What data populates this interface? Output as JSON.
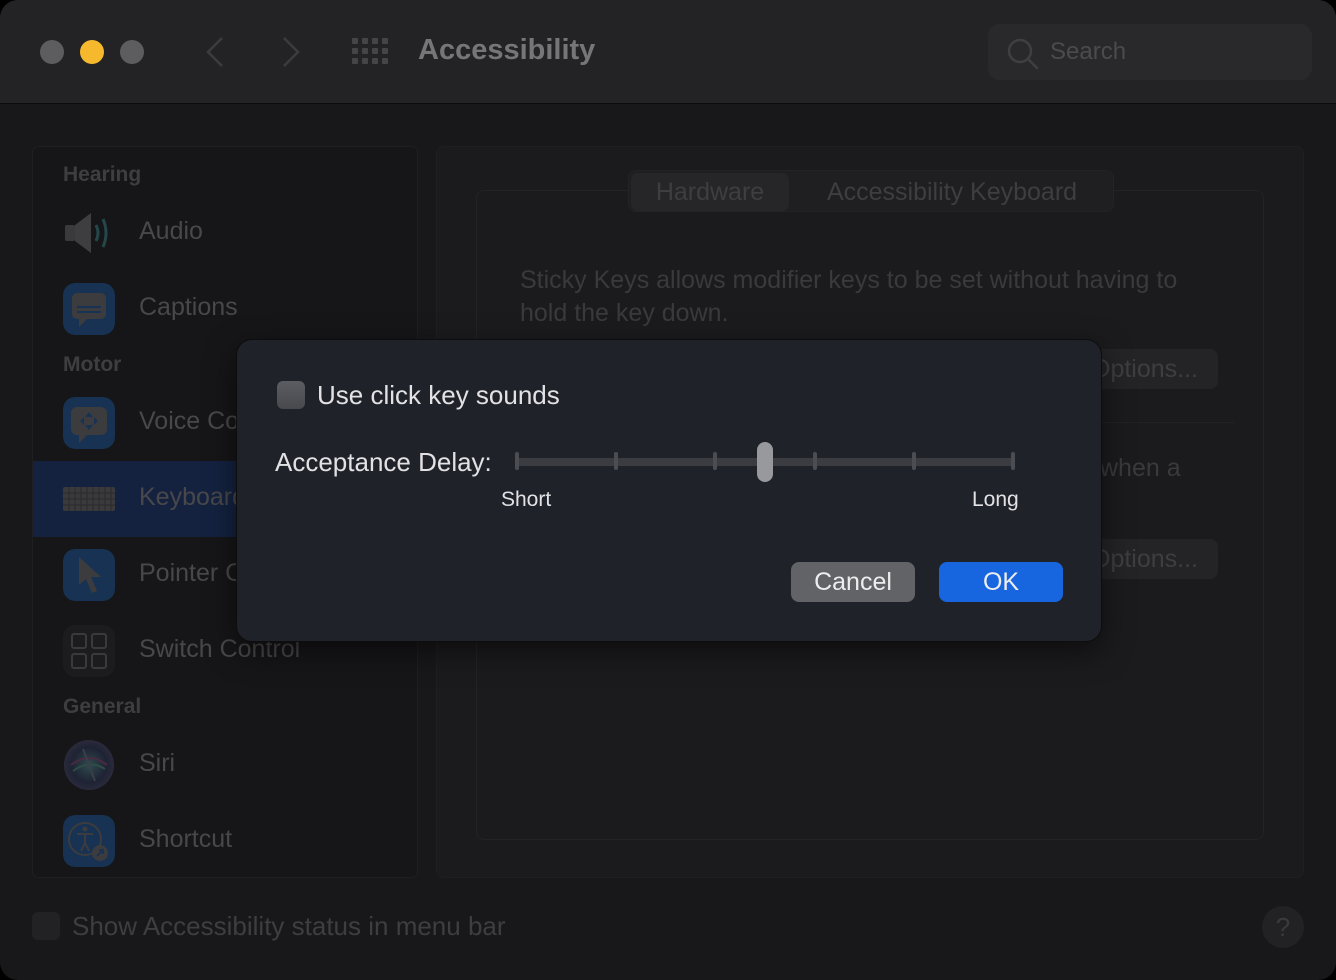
{
  "window": {
    "title": "Accessibility",
    "traffic_lights": [
      "close",
      "minimize",
      "zoom"
    ],
    "search": {
      "placeholder": "Search",
      "value": ""
    }
  },
  "sidebar": {
    "sections": [
      {
        "label": "Hearing"
      },
      {
        "label": "Motor"
      },
      {
        "label": "General"
      }
    ],
    "items": [
      {
        "label": "Audio",
        "icon": "speaker-icon",
        "section": "Hearing"
      },
      {
        "label": "Captions",
        "icon": "captions-icon",
        "section": "Hearing"
      },
      {
        "label": "Voice Control",
        "icon": "voice-control-icon",
        "section": "Motor"
      },
      {
        "label": "Keyboard",
        "icon": "keyboard-icon",
        "section": "Motor",
        "selected": true
      },
      {
        "label": "Pointer Control",
        "icon": "pointer-icon",
        "section": "Motor"
      },
      {
        "label": "Switch Control",
        "icon": "switch-control-icon",
        "section": "Motor"
      },
      {
        "label": "Siri",
        "icon": "siri-icon",
        "section": "General"
      },
      {
        "label": "Shortcut",
        "icon": "accessibility-shortcut-icon",
        "section": "General"
      }
    ]
  },
  "main": {
    "tabs": [
      {
        "label": "Hardware",
        "active": true
      },
      {
        "label": "Accessibility Keyboard",
        "active": false
      }
    ],
    "sticky_keys_description": "Sticky Keys allows modifier keys to be set without having to hold the key down.",
    "slow_keys_description_partial": "when a",
    "options_button_1": "Options...",
    "options_button_2": "Options..."
  },
  "footer": {
    "show_status_label": "Show Accessibility status in menu bar",
    "show_status_checked": false,
    "help_label": "?"
  },
  "dialog": {
    "click_sounds_label": "Use click key sounds",
    "click_sounds_checked": false,
    "acceptance_delay_label": "Acceptance Delay:",
    "slider": {
      "min_label": "Short",
      "max_label": "Long",
      "tick_count": 6,
      "value_fraction": 0.5
    },
    "cancel_label": "Cancel",
    "ok_label": "OK"
  },
  "colors": {
    "accent": "#1766e0",
    "traffic_minimize": "#f6b92d",
    "selected_row": "#142240"
  }
}
